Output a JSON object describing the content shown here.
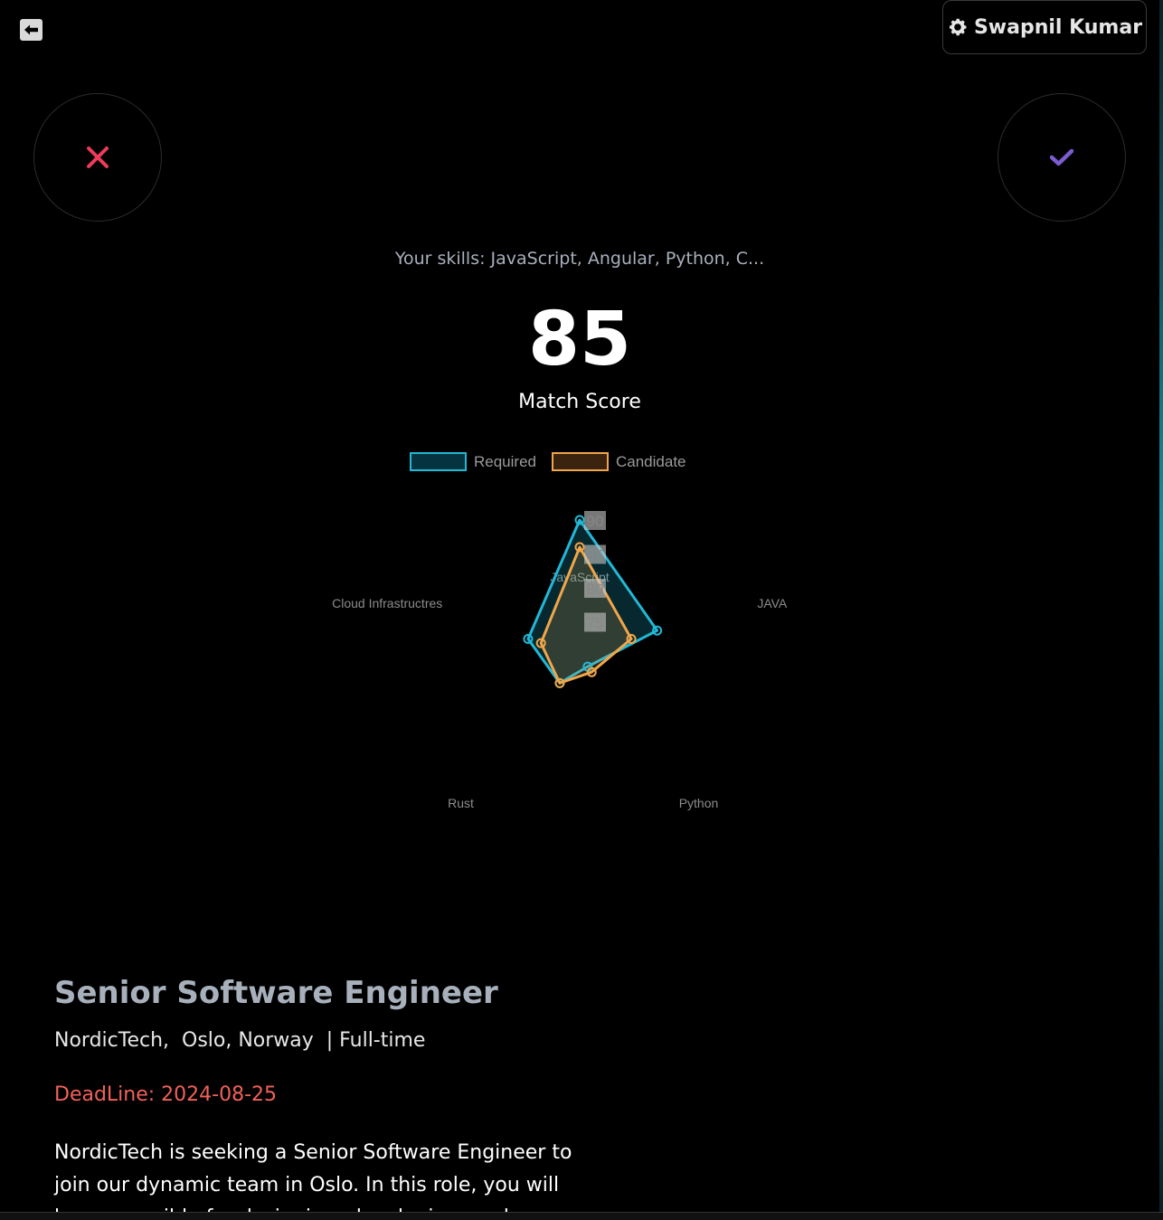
{
  "header": {
    "user_name": "Swapnil Kumar"
  },
  "skills_summary": "Your skills: JavaScript, Angular, Python, C...",
  "match": {
    "score": "85",
    "label": "Match Score"
  },
  "colors": {
    "required": "#22b8d6",
    "candidate": "#f0a64a",
    "reject": "#ee3b5b",
    "accept": "#7c5cd1",
    "deadline": "#f0625a"
  },
  "chart_data": {
    "type": "radar",
    "categories": [
      "JavaScript",
      "JAVA",
      "Python",
      "Rust",
      "Cloud Infrastructres"
    ],
    "series": [
      {
        "name": "Required",
        "values": [
          90,
          82,
          72,
          75,
          78
        ]
      },
      {
        "name": "Candidate",
        "values": [
          86,
          78,
          73,
          75,
          76
        ]
      }
    ],
    "rlim": [
      70,
      90
    ],
    "ticks": [
      "75",
      "80",
      "85",
      "90"
    ],
    "legend": "top"
  },
  "job": {
    "title": "Senior Software Engineer",
    "meta": "NordicTech,  Oslo, Norway  | Full-time",
    "deadline": "DeadLine: 2024-08-25",
    "description": "NordicTech is seeking a Senior Software Engineer to join our dynamic team in Oslo. In this role, you will be responsible for designing, developing, and"
  }
}
